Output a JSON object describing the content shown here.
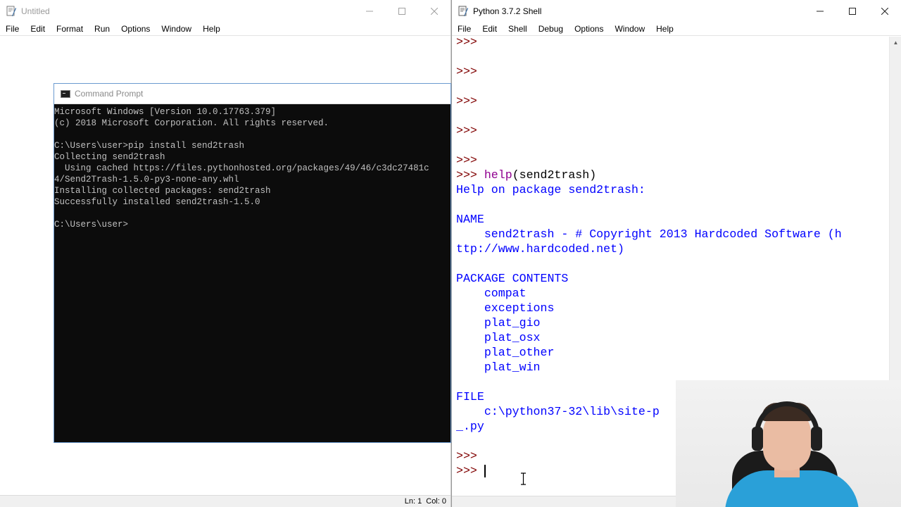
{
  "editor": {
    "title": "Untitled",
    "menu": [
      "File",
      "Edit",
      "Format",
      "Run",
      "Options",
      "Window",
      "Help"
    ],
    "status": {
      "line": "Ln: 1",
      "col": "Col: 0"
    }
  },
  "cmd": {
    "title": "Command Prompt",
    "lines": [
      "Microsoft Windows [Version 10.0.17763.379]",
      "(c) 2018 Microsoft Corporation. All rights reserved.",
      "",
      "C:\\Users\\user>pip install send2trash",
      "Collecting send2trash",
      "  Using cached https://files.pythonhosted.org/packages/49/46/c3dc27481c",
      "4/Send2Trash-1.5.0-py3-none-any.whl",
      "Installing collected packages: send2trash",
      "Successfully installed send2trash-1.5.0",
      "",
      "C:\\Users\\user>"
    ]
  },
  "shell": {
    "title": "Python 3.7.2 Shell",
    "menu": [
      "File",
      "Edit",
      "Shell",
      "Debug",
      "Options",
      "Window",
      "Help"
    ],
    "prompt": ">>>",
    "command": {
      "func": "help",
      "args": "(send2trash)"
    },
    "output": {
      "header": "Help on package send2trash:",
      "name_heading": "NAME",
      "name_line1": "    send2trash - # Copyright 2013 Hardcoded Software (h",
      "name_line2": "ttp://www.hardcoded.net)",
      "contents_heading": "PACKAGE CONTENTS",
      "contents": [
        "compat",
        "exceptions",
        "plat_gio",
        "plat_osx",
        "plat_other",
        "plat_win"
      ],
      "file_heading": "FILE",
      "file_line1": "    c:\\python37-32\\lib\\site-p",
      "file_line2": "_.py"
    }
  },
  "colors": {
    "prompt": "#800000",
    "stdout": "#0000ff",
    "builtin": "#900090",
    "console_text": "#c0c0c0",
    "console_bg": "#0c0c0c"
  },
  "icons": {
    "minimize": "minimize-icon",
    "maximize": "maximize-icon",
    "close": "close-icon"
  }
}
